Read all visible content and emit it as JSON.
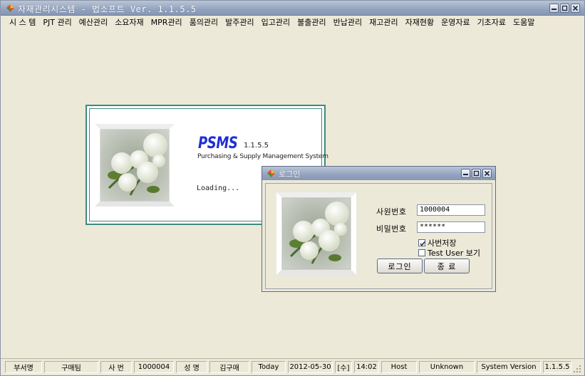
{
  "window": {
    "title": "자재관리시스템 - 법소프트 Ver. 1.1.5.5"
  },
  "menu": [
    "시 스 템",
    "PJT 관리",
    "예산관리",
    "소요자재",
    "MPR관리",
    "품의관리",
    "발주관리",
    "입고관리",
    "불출관리",
    "반납관리",
    "재고관리",
    "자재현황",
    "운영자료",
    "기초자료",
    "도움말"
  ],
  "splash": {
    "logo": "PSMS",
    "version": "1.1.5.5",
    "subtitle": "Purchasing & Supply Management System",
    "loading": "Loading..."
  },
  "login": {
    "title": "로그인",
    "employee_label": "사원번호",
    "employee_value": "1000004",
    "password_label": "비밀번호",
    "password_value": "******",
    "save_id_label": "사번저장",
    "save_id_checked": true,
    "test_user_label": "Test User 보기",
    "test_user_checked": false,
    "login_button": "로그인",
    "exit_button": "종 료"
  },
  "status": {
    "dept_label": "부서명",
    "dept_value": "구매팀",
    "emp_label": "사 번",
    "emp_value": "1000004",
    "name_label": "성 명",
    "name_value": "김구매",
    "today_label": "Today",
    "date_value": "2012-05-30",
    "weekday": "[수]",
    "time": "14:02",
    "host_label": "Host",
    "host_value": "Unknown",
    "version_label": "System Version",
    "version_value": "1.1.5.5"
  },
  "colors": {
    "titlebar": "#93a3bf",
    "face": "#ece9d8",
    "splash_border": "#3f8a7e",
    "logo": "#1f2fd6"
  },
  "icons": {
    "app": "app-logo-icon",
    "minimize": "minimize-icon",
    "maximize": "maximize-icon",
    "close": "close-icon"
  }
}
